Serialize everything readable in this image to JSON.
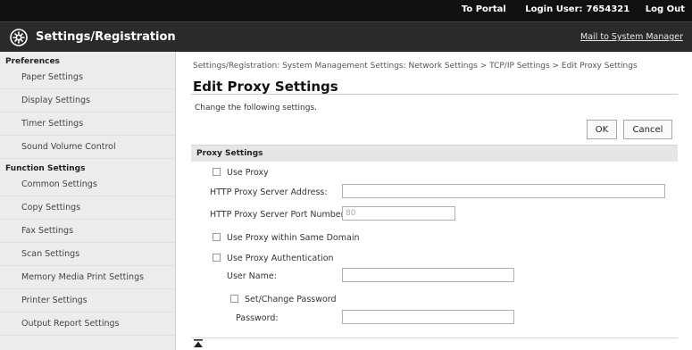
{
  "topbar": {
    "portal_link": "To Portal",
    "login_label": "Login User:",
    "login_user": "7654321",
    "logout_link": "Log Out"
  },
  "header": {
    "app_icon": "gear-settings-icon",
    "title": "Settings/Registration",
    "mail_link": "Mail to System Manager"
  },
  "sidebar": {
    "groups": [
      {
        "title": "Preferences",
        "items": [
          "Paper Settings",
          "Display Settings",
          "Timer Settings",
          "Sound Volume Control"
        ]
      },
      {
        "title": "Function Settings",
        "items": [
          "Common Settings",
          "Copy Settings",
          "Fax Settings",
          "Scan Settings",
          "Memory Media Print Settings",
          "Printer Settings",
          "Output Report Settings"
        ]
      }
    ]
  },
  "main": {
    "breadcrumb": "Settings/Registration: System Management Settings: Network Settings > TCP/IP Settings > Edit Proxy Settings",
    "title": "Edit Proxy Settings",
    "instruction": "Change the following settings.",
    "ok_label": "OK",
    "cancel_label": "Cancel",
    "section_title": "Proxy Settings",
    "use_proxy": {
      "label": "Use Proxy",
      "checked": false
    },
    "http_address": {
      "label": "HTTP Proxy Server Address:",
      "value": ""
    },
    "http_port": {
      "label": "HTTP Proxy Server Port Number:",
      "placeholder": "80"
    },
    "same_domain": {
      "label": "Use Proxy within Same Domain",
      "checked": false
    },
    "proxy_auth": {
      "label": "Use Proxy Authentication",
      "checked": false
    },
    "user_name": {
      "label": "User Name:",
      "value": ""
    },
    "set_password": {
      "label": "Set/Change Password",
      "checked": false
    },
    "password": {
      "label": "Password:",
      "value": ""
    }
  },
  "colors": {
    "topbar_bg": "#111111",
    "header_bg": "#2a2a2a",
    "sidebar_bg": "#ececec",
    "section_bg": "#e6e6e6"
  }
}
